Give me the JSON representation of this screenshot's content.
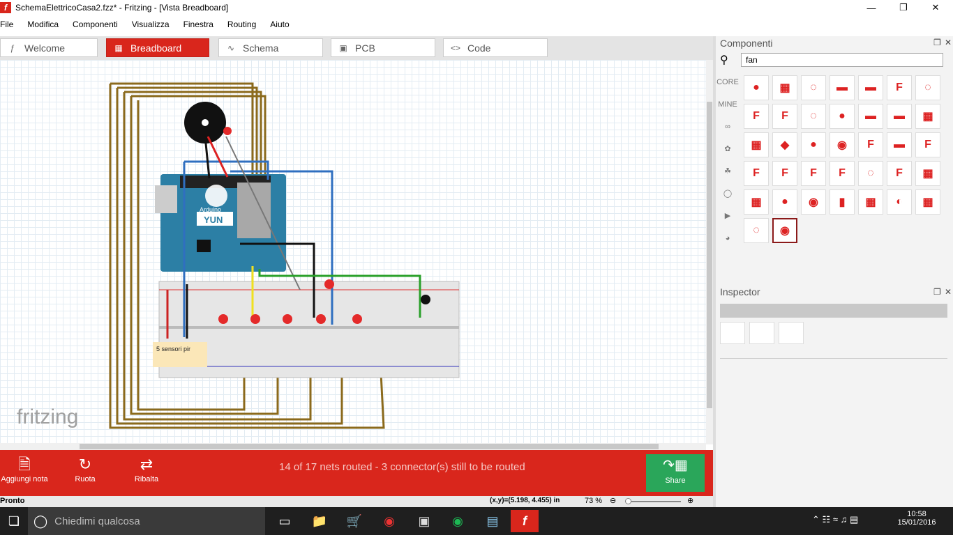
{
  "window": {
    "title": "SchemaElettricoCasa2.fzz* - Fritzing - [Vista Breadboard]",
    "app_icon": "f"
  },
  "menu": [
    "File",
    "Modifica",
    "Componenti",
    "Visualizza",
    "Finestra",
    "Routing",
    "Aiuto"
  ],
  "tabs": [
    {
      "label": "Welcome",
      "icon": "fritzing-icon"
    },
    {
      "label": "Breadboard",
      "icon": "breadboard-icon",
      "active": true
    },
    {
      "label": "Schema",
      "icon": "schematic-icon"
    },
    {
      "label": "PCB",
      "icon": "pcb-icon"
    },
    {
      "label": "Code",
      "icon": "code-icon"
    }
  ],
  "canvas": {
    "note_text": "5 sensori pir",
    "watermark": "fritzing",
    "board_brand": "Arduino",
    "board_name": "YUN"
  },
  "toolbar": {
    "add_note": "Aggiungi nota",
    "rotate": "Ruota",
    "flip": "Ribalta",
    "routing_status": "14 of 17 nets routed - 3 connector(s) still to be routed",
    "share": "Share"
  },
  "statusbar": {
    "left": "Pronto",
    "coords": "(x,y)=(5.198, 4.455) in",
    "zoom": "73 %"
  },
  "components_panel": {
    "title": "Componenti",
    "search_value": "fan",
    "bins": [
      "CORE",
      "MINE"
    ]
  },
  "inspector_panel": {
    "title": "Inspector"
  },
  "taskbar": {
    "search_placeholder": "Chiedimi qualcosa",
    "time": "10:58",
    "date": "15/01/2016"
  },
  "colors": {
    "accent": "#d9261c",
    "share": "#2aa65a",
    "arduino": "#2c7fa5"
  }
}
